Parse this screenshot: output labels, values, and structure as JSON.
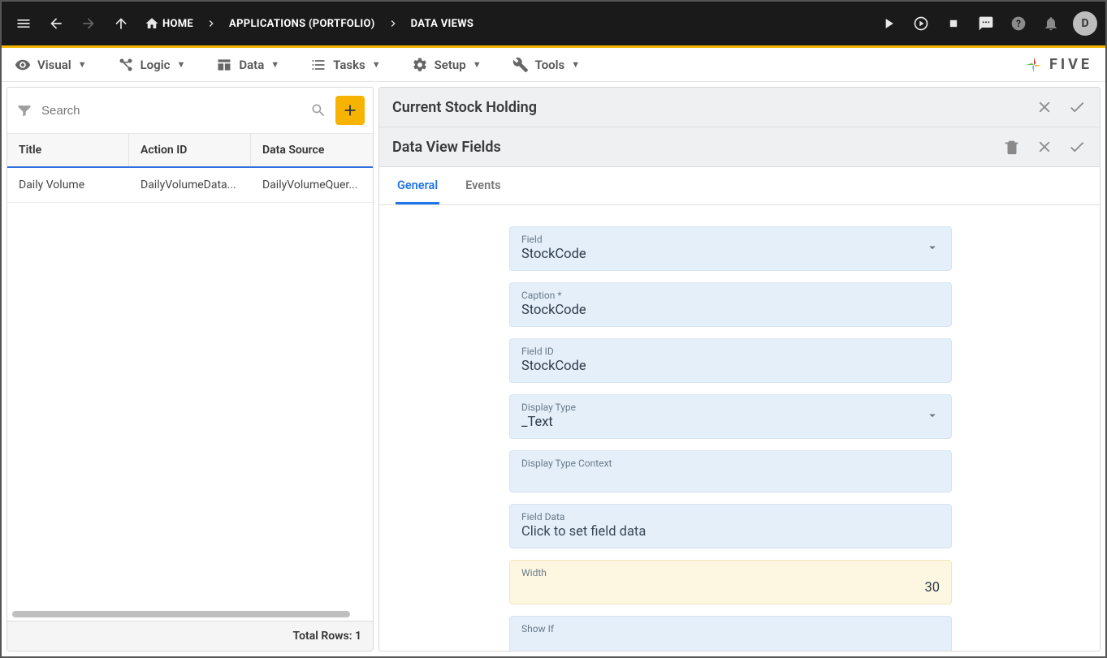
{
  "topbar": {
    "breadcrumbs": [
      "HOME",
      "APPLICATIONS (PORTFOLIO)",
      "DATA VIEWS"
    ],
    "avatar_initial": "D"
  },
  "menubar": {
    "items": [
      "Visual",
      "Logic",
      "Data",
      "Tasks",
      "Setup",
      "Tools"
    ],
    "brand": "FIVE"
  },
  "left": {
    "search_placeholder": "Search",
    "columns": [
      "Title",
      "Action ID",
      "Data Source"
    ],
    "rows": [
      {
        "title": "Daily Volume",
        "action_id": "DailyVolumeData...",
        "data_source": "DailyVolumeQuer..."
      }
    ],
    "footer_label": "Total Rows:",
    "footer_count": "1"
  },
  "right": {
    "header_title": "Current Stock Holding",
    "sub_header_title": "Data View Fields",
    "tabs": [
      "General",
      "Events"
    ],
    "fields": {
      "field_label": "Field",
      "field_value": "StockCode",
      "caption_label": "Caption *",
      "caption_value": "StockCode",
      "fieldid_label": "Field ID",
      "fieldid_value": "StockCode",
      "displaytype_label": "Display Type",
      "displaytype_value": "_Text",
      "displaytypectx_label": "Display Type Context",
      "displaytypectx_value": "",
      "fielddata_label": "Field Data",
      "fielddata_value": "Click to set field data",
      "width_label": "Width",
      "width_value": "30",
      "showif_label": "Show If",
      "showif_value": ""
    }
  }
}
